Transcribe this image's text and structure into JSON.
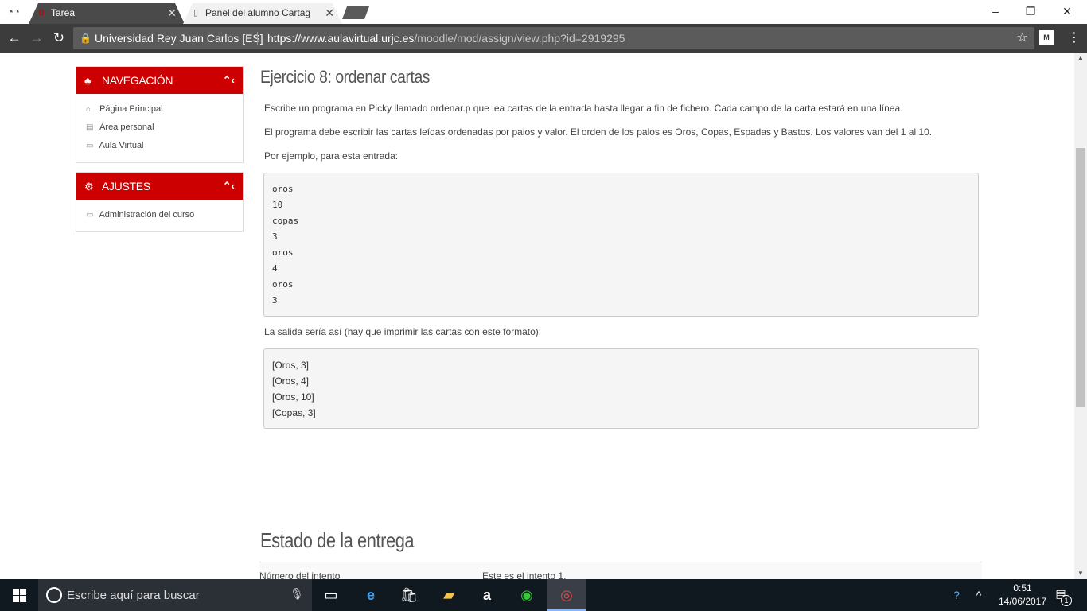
{
  "browser": {
    "incognito_icon": "incognito-icon",
    "tabs": [
      {
        "title": "Tarea",
        "active": true
      },
      {
        "title": "Panel del alumno Cartag",
        "active": false
      }
    ],
    "window_controls": {
      "minimize": "–",
      "restore": "❐",
      "close": "✕"
    },
    "site_identity": "Universidad Rey Juan Carlos [ES]",
    "url_host": "https://www.aulavirtual.urjc.es",
    "url_path": "/moodle/mod/assign/view.php?id=2919295",
    "extension_label": "M"
  },
  "sidebar": {
    "navigation": {
      "title": "NAVEGACIÓN",
      "items": [
        {
          "label": "Página Principal",
          "icon": "home-icon"
        },
        {
          "label": "Área personal",
          "icon": "document-icon"
        },
        {
          "label": "Aula Virtual",
          "icon": "folder-icon"
        }
      ]
    },
    "settings": {
      "title": "AJUSTES",
      "items": [
        {
          "label": "Administración del curso",
          "icon": "folder-icon"
        }
      ]
    }
  },
  "main": {
    "title": "Ejercicio 8: ordenar cartas",
    "paragraphs": [
      "Escribe un programa en Picky llamado ordenar.p que lea cartas de la entrada hasta llegar a fin de fichero. Cada campo de la carta estará en una línea.",
      "El programa debe escribir las cartas leídas ordenadas por palos y valor. El orden de los palos es Oros, Copas, Espadas y Bastos. Los valores van del 1 al 10.",
      "Por ejemplo, para esta entrada:",
      "La salida sería así (hay que imprimir las cartas con este formato):"
    ],
    "input_example": [
      "oros",
      "10",
      "copas",
      "3",
      "oros",
      "4",
      "oros",
      "3"
    ],
    "output_example": [
      "[Oros, 3]",
      "[Oros, 4]",
      "[Oros, 10]",
      "[Copas, 3]"
    ],
    "status_title": "Estado de la entrega",
    "status_rows": [
      {
        "key": "Número del intento",
        "value": "Este es el intento 1."
      }
    ]
  },
  "taskbar": {
    "search_placeholder": "Escribe aquí para buscar",
    "time": "0:51",
    "date": "14/06/2017",
    "notification_count": "1"
  }
}
